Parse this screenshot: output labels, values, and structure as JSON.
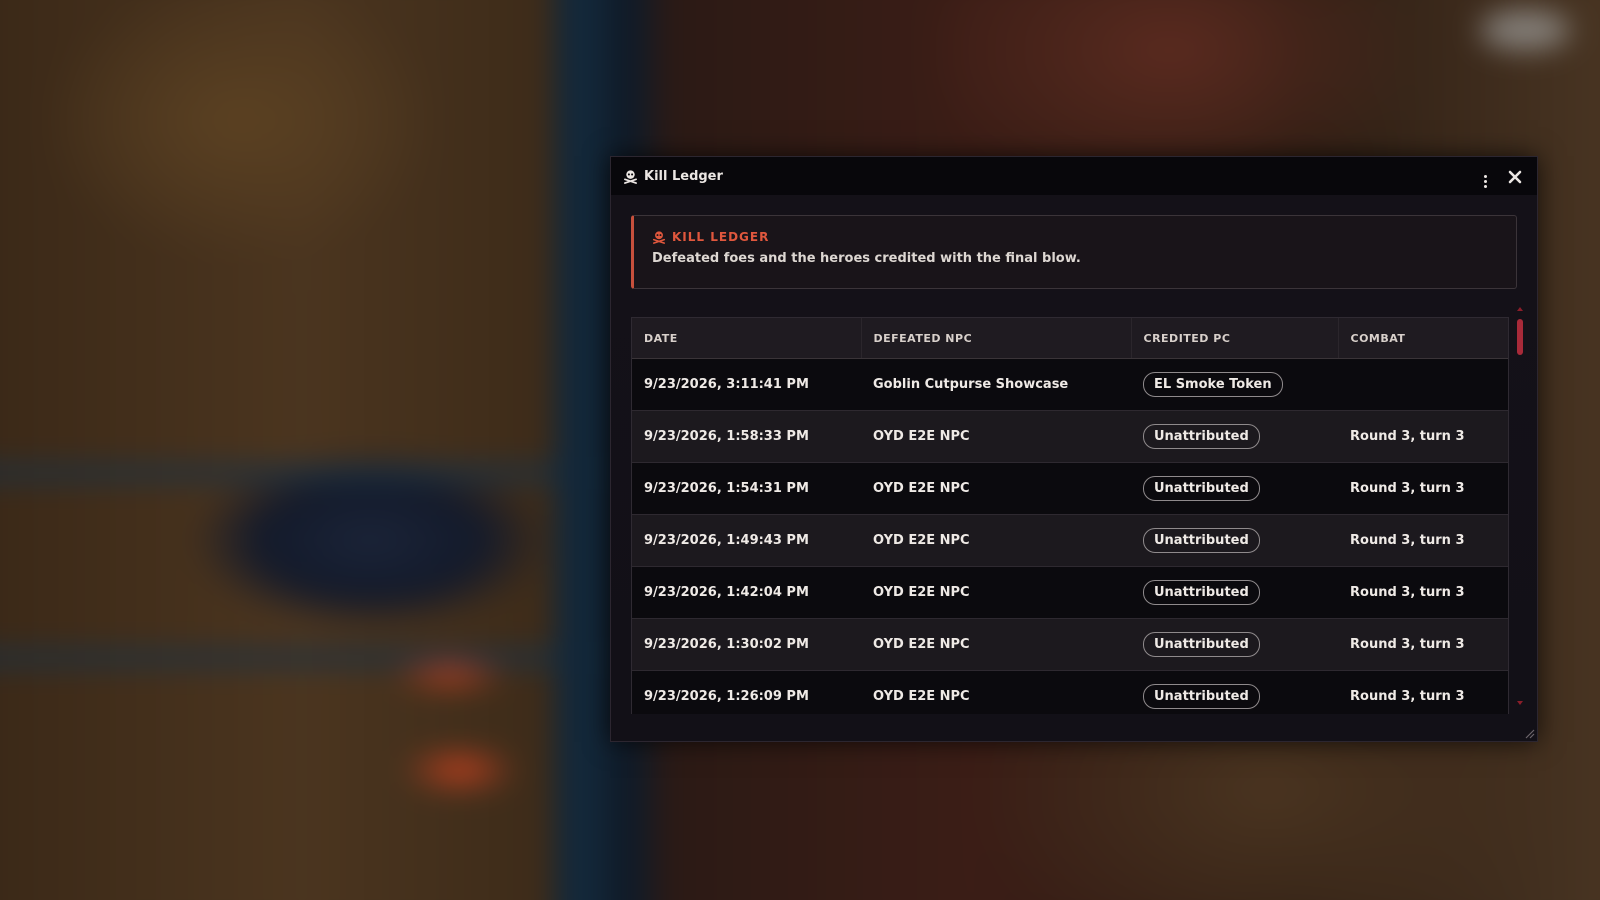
{
  "window": {
    "title": "Kill Ledger",
    "menu_icon": "kebab-menu-icon",
    "close_icon": "close-icon",
    "title_icon": "skull-icon"
  },
  "header": {
    "eyebrow": "KILL LEDGER",
    "subtitle": "Defeated foes and the heroes credited with the final blow.",
    "accent_color": "#c7503c"
  },
  "table": {
    "columns": [
      "DATE",
      "DEFEATED NPC",
      "CREDITED PC",
      "COMBAT"
    ],
    "rows": [
      {
        "date": "9/23/2026, 3:11:41 PM",
        "npc": "Goblin Cutpurse Showcase",
        "pc": "EL Smoke Token",
        "combat": ""
      },
      {
        "date": "9/23/2026, 1:58:33 PM",
        "npc": "OYD E2E NPC",
        "pc": "Unattributed",
        "combat": "Round 3, turn 3"
      },
      {
        "date": "9/23/2026, 1:54:31 PM",
        "npc": "OYD E2E NPC",
        "pc": "Unattributed",
        "combat": "Round 3, turn 3"
      },
      {
        "date": "9/23/2026, 1:49:43 PM",
        "npc": "OYD E2E NPC",
        "pc": "Unattributed",
        "combat": "Round 3, turn 3"
      },
      {
        "date": "9/23/2026, 1:42:04 PM",
        "npc": "OYD E2E NPC",
        "pc": "Unattributed",
        "combat": "Round 3, turn 3"
      },
      {
        "date": "9/23/2026, 1:30:02 PM",
        "npc": "OYD E2E NPC",
        "pc": "Unattributed",
        "combat": "Round 3, turn 3"
      },
      {
        "date": "9/23/2026, 1:26:09 PM",
        "npc": "OYD E2E NPC",
        "pc": "Unattributed",
        "combat": "Round 3, turn 3"
      }
    ]
  },
  "colors": {
    "scrollbar": "#a82a39",
    "eyebrow": "#e0573d"
  }
}
